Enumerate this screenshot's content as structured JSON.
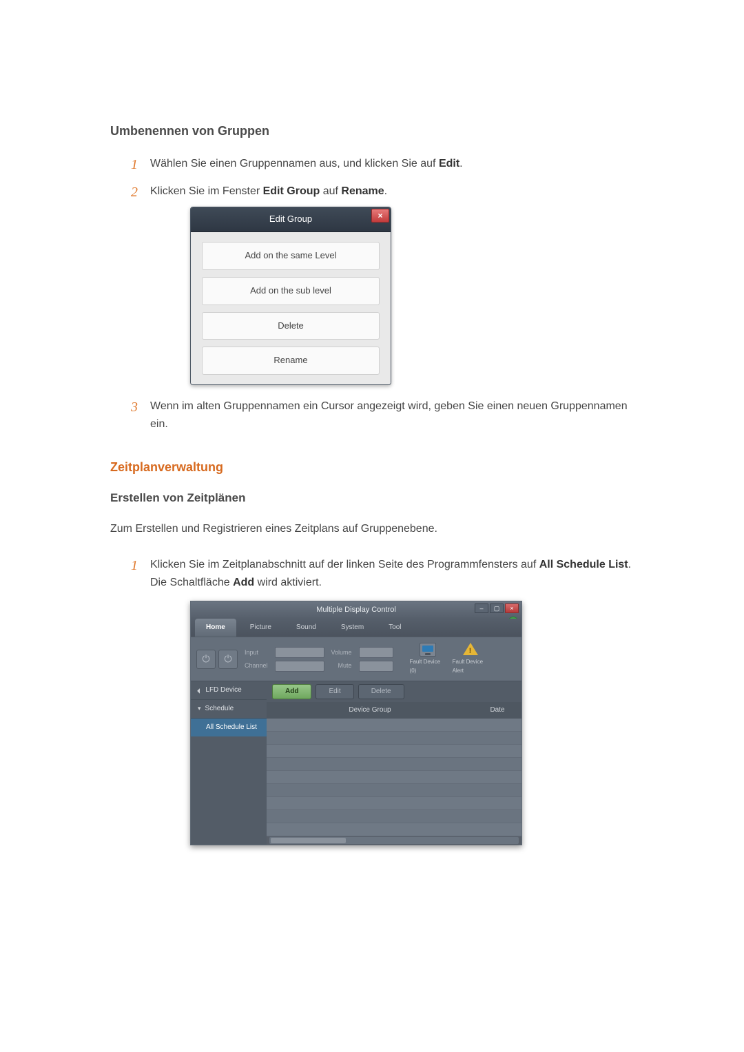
{
  "section_rename": {
    "heading": "Umbenennen von Gruppen",
    "steps": [
      {
        "num": "1",
        "pre": "Wählen Sie einen Gruppennamen aus, und klicken Sie auf ",
        "bold": "Edit",
        "post": "."
      },
      {
        "num": "2",
        "pre": "Klicken Sie im Fenster ",
        "bold1": "Edit Group",
        "mid": " auf ",
        "bold2": "Rename",
        "post": "."
      },
      {
        "num": "3",
        "pre": "Wenn im alten Gruppennamen ein Cursor angezeigt wird, geben Sie einen neuen Gruppennamen ein."
      }
    ]
  },
  "edit_group_dialog": {
    "title": "Edit Group",
    "btn_same": "Add on the same Level",
    "btn_sub": "Add on the sub level",
    "btn_delete": "Delete",
    "btn_rename": "Rename"
  },
  "section_schedule": {
    "heading": "Zeitplanverwaltung",
    "subheading": "Erstellen von Zeitplänen",
    "intro": "Zum Erstellen und Registrieren eines Zeitplans auf Gruppenebene.",
    "step1_pre": "Klicken Sie im Zeitplanabschnitt auf der linken Seite des Programmfensters auf ",
    "step1_bold": "All Schedule List",
    "step1_mid": ". Die Schaltfläche ",
    "step1_bold2": "Add",
    "step1_post": " wird aktiviert.",
    "step1_num": "1"
  },
  "mdc": {
    "title": "Multiple Display Control",
    "tabs": {
      "home": "Home",
      "picture": "Picture",
      "sound": "Sound",
      "system": "System",
      "tool": "Tool"
    },
    "toolbar": {
      "on": "On",
      "off": "Off",
      "input_label": "Input",
      "channel_label": "Channel",
      "volume_label": "Volume",
      "mute_label": "Mute",
      "fault_device": "Fault Device (0)",
      "fault_alert": "Fault Device Alert"
    },
    "side": {
      "lfd": "LFD Device",
      "schedule": "Schedule",
      "all_list": "All Schedule List"
    },
    "buttons": {
      "add": "Add",
      "edit": "Edit",
      "delete": "Delete"
    },
    "columns": {
      "device_group": "Device Group",
      "date": "Date"
    },
    "help": "?"
  }
}
